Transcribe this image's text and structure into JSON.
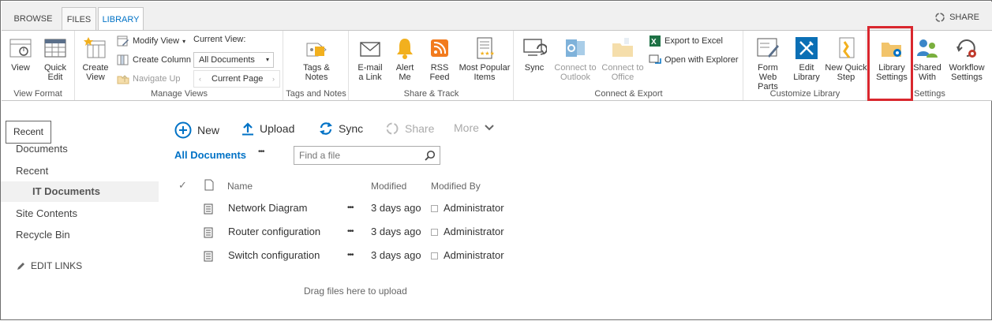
{
  "tabs": {
    "browse": "BROWSE",
    "files": "FILES",
    "library": "LIBRARY"
  },
  "share_top": "SHARE",
  "ribbon": {
    "view_format": {
      "label": "View Format",
      "view": "View",
      "quick_edit": "Quick Edit"
    },
    "manage_views": {
      "label": "Manage Views",
      "create_view": "Create View",
      "modify_view": "Modify View",
      "create_column": "Create Column",
      "navigate_up": "Navigate Up",
      "current_view_label": "Current View:",
      "current_view_value": "All Documents",
      "current_page": "Current Page"
    },
    "tags_notes": {
      "label": "Tags and Notes",
      "tags_notes_btn": "Tags & Notes"
    },
    "share_track": {
      "label": "Share & Track",
      "email": "E-mail a Link",
      "alert": "Alert Me",
      "rss": "RSS Feed",
      "popular": "Most Popular Items"
    },
    "connect_export": {
      "label": "Connect & Export",
      "sync": "Sync",
      "outlook": "Connect to Outlook",
      "office": "Connect to Office",
      "export_excel": "Export to Excel",
      "open_explorer": "Open with Explorer"
    },
    "customize": {
      "label": "Customize Library",
      "form_web_parts": "Form Web Parts",
      "edit_library": "Edit Library",
      "new_quick_step": "New Quick Step"
    },
    "settings": {
      "label": "Settings",
      "library_settings": "Library Settings",
      "shared_with": "Shared With",
      "workflow_settings": "Workflow Settings"
    }
  },
  "left_nav": {
    "recent_box": "Recent",
    "documents": "Documents",
    "recent": "Recent",
    "it_documents": "IT Documents",
    "site_contents": "Site Contents",
    "recycle_bin": "Recycle Bin",
    "edit_links": "EDIT LINKS"
  },
  "commands": {
    "new": "New",
    "upload": "Upload",
    "sync": "Sync",
    "share": "Share",
    "more": "More"
  },
  "view": {
    "all_documents": "All Documents",
    "ellipsis": "•••",
    "search_placeholder": "Find a file"
  },
  "table": {
    "headers": {
      "name": "Name",
      "modified": "Modified",
      "modified_by": "Modified By"
    },
    "rows": [
      {
        "name": "Network Diagram",
        "modified": "3 days ago",
        "modified_by": "Administrator"
      },
      {
        "name": "Router configuration",
        "modified": "3 days ago",
        "modified_by": "Administrator"
      },
      {
        "name": "Switch configuration",
        "modified": "3 days ago",
        "modified_by": "Administrator"
      }
    ],
    "row_ellipsis": "•••"
  },
  "drag_hint": "Drag files here to upload",
  "colors": {
    "accent": "#0072c6",
    "highlight": "#d9272e",
    "tabbar": "#f0f0f0"
  }
}
